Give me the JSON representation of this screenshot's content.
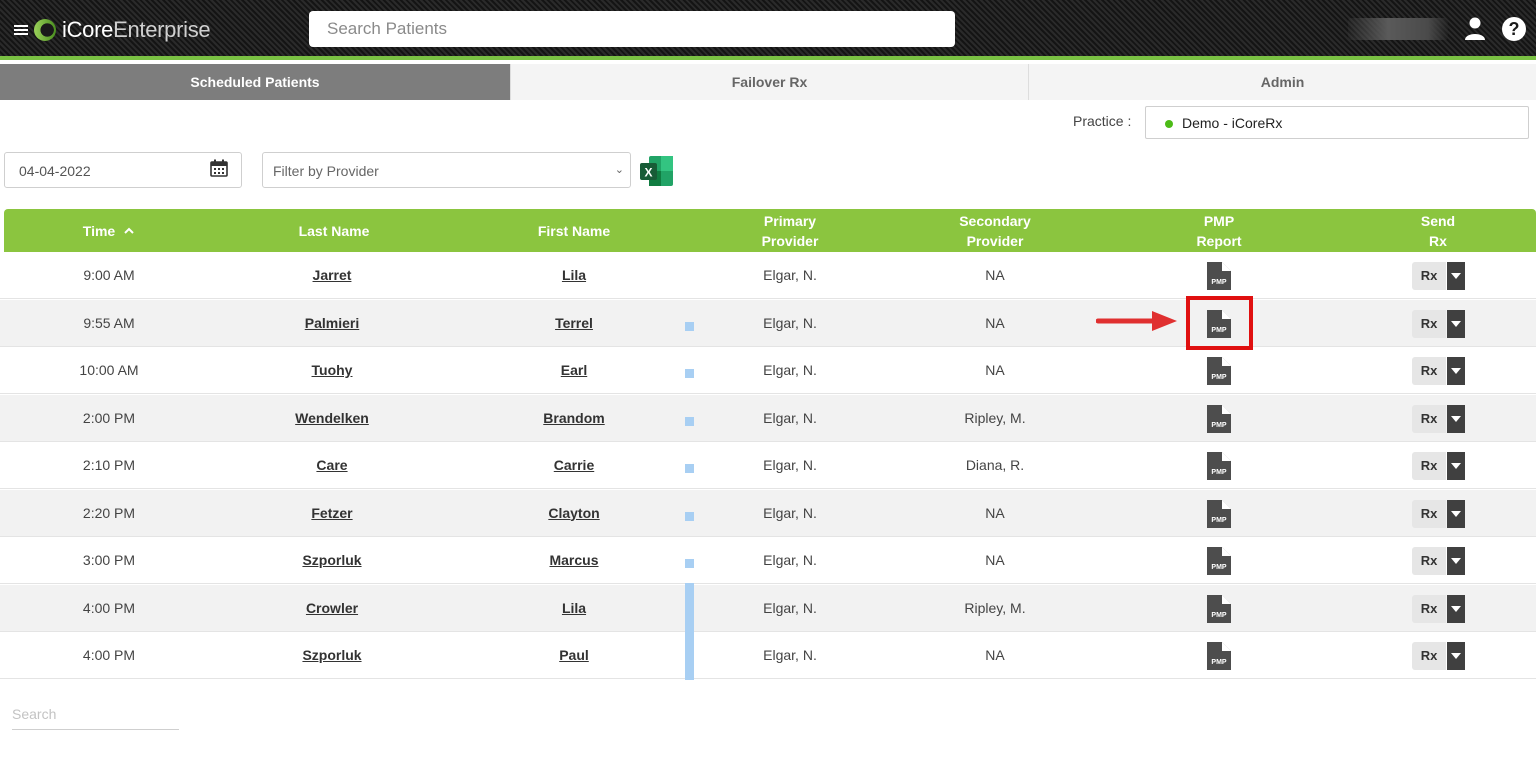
{
  "app": {
    "logo_core": "iCore",
    "logo_enterprise": "Enterprise",
    "search_placeholder": "Search Patients"
  },
  "tabs": [
    {
      "label": "Scheduled Patients",
      "active": true
    },
    {
      "label": "Failover Rx",
      "active": false
    },
    {
      "label": "Admin",
      "active": false
    }
  ],
  "practice": {
    "label": "Practice :",
    "value": "Demo - iCoreRx",
    "status_color": "#4cbb17"
  },
  "filters": {
    "date": "04-04-2022",
    "provider_placeholder": "Filter by Provider"
  },
  "table": {
    "columns": {
      "time": "Time",
      "last_name": "Last Name",
      "first_name": "First Name",
      "primary_provider_1": "Primary",
      "primary_provider_2": "Provider",
      "secondary_provider_1": "Secondary",
      "secondary_provider_2": "Provider",
      "pmp_report_1": "PMP",
      "pmp_report_2": "Report",
      "send_rx_1": "Send",
      "send_rx_2": "Rx"
    },
    "sort": "time ascending",
    "rows": [
      {
        "time": "9:00 AM",
        "last": "Jarret",
        "first": "Lila",
        "primary": "Elgar, N.",
        "secondary": "NA",
        "marker": "none",
        "rx": "Rx"
      },
      {
        "time": "9:55 AM",
        "last": "Palmieri",
        "first": "Terrel",
        "primary": "Elgar, N.",
        "secondary": "NA",
        "marker": "square",
        "rx": "Rx"
      },
      {
        "time": "10:00 AM",
        "last": "Tuohy",
        "first": "Earl",
        "primary": "Elgar, N.",
        "secondary": "NA",
        "marker": "square",
        "rx": "Rx"
      },
      {
        "time": "2:00 PM",
        "last": "Wendelken",
        "first": "Brandom",
        "primary": "Elgar, N.",
        "secondary": "Ripley, M.",
        "marker": "square",
        "rx": "Rx"
      },
      {
        "time": "2:10 PM",
        "last": "Care",
        "first": "Carrie",
        "primary": "Elgar, N.",
        "secondary": "Diana, R.",
        "marker": "square",
        "rx": "Rx"
      },
      {
        "time": "2:20 PM",
        "last": "Fetzer",
        "first": "Clayton",
        "primary": "Elgar, N.",
        "secondary": "NA",
        "marker": "square",
        "rx": "Rx"
      },
      {
        "time": "3:00 PM",
        "last": "Szporluk",
        "first": "Marcus",
        "primary": "Elgar, N.",
        "secondary": "NA",
        "marker": "square",
        "rx": "Rx"
      },
      {
        "time": "4:00 PM",
        "last": "Crowler",
        "first": "Lila",
        "primary": "Elgar, N.",
        "secondary": "Ripley, M.",
        "marker": "bar",
        "rx": "Rx"
      },
      {
        "time": "4:00 PM",
        "last": "Szporluk",
        "first": "Paul",
        "primary": "Elgar, N.",
        "secondary": "NA",
        "marker": "bar",
        "rx": "Rx"
      }
    ]
  },
  "pmp_icon_text": "PMP",
  "annotation": {
    "highlight_row": 1,
    "color": "#e01010"
  },
  "bottom_search_placeholder": "Search",
  "colors": {
    "header_green": "#8bc53f",
    "accent_green": "#7ac143",
    "marker_blue": "#a8cff3"
  }
}
